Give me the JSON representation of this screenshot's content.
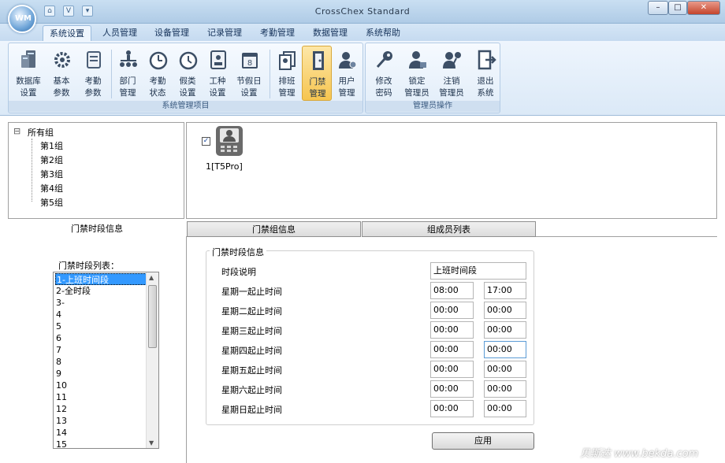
{
  "window": {
    "title": "CrossChex Standard",
    "logo_text": "WM",
    "quick_access": [
      "⌂",
      "V",
      "▾"
    ],
    "controls": [
      "–",
      "□",
      "✕"
    ]
  },
  "menu_tabs": [
    "系统设置",
    "人员管理",
    "设备管理",
    "记录管理",
    "考勤管理",
    "数据管理",
    "系统帮助"
  ],
  "ribbon": {
    "group1": {
      "label": "系统管理项目",
      "buttons": [
        {
          "line1": "数据库",
          "line2": "设置",
          "icon": "database-icon"
        },
        {
          "line1": "基本",
          "line2": "参数",
          "icon": "gear-icon"
        },
        {
          "line1": "考勤",
          "line2": "参数",
          "icon": "scroll-icon"
        },
        {
          "line1": "部门",
          "line2": "管理",
          "icon": "org-chart-icon"
        },
        {
          "line1": "考勤",
          "line2": "状态",
          "icon": "alarm-clock-icon"
        },
        {
          "line1": "假类",
          "line2": "设置",
          "icon": "clock-icon"
        },
        {
          "line1": "工种",
          "line2": "设置",
          "icon": "id-card-icon"
        },
        {
          "line1": "节假日",
          "line2": "设置",
          "icon": "calendar-icon"
        },
        {
          "line1": "排班",
          "line2": "管理",
          "icon": "schedule-icon"
        },
        {
          "line1": "门禁",
          "line2": "管理",
          "icon": "door-icon"
        },
        {
          "line1": "用户",
          "line2": "管理",
          "icon": "user-gear-icon"
        }
      ]
    },
    "group2": {
      "label": "管理员操作",
      "buttons": [
        {
          "line1": "修改",
          "line2": "密码",
          "icon": "key-icon"
        },
        {
          "line1": "锁定",
          "line2": "管理员",
          "icon": "user-lock-icon"
        },
        {
          "line1": "注销",
          "line2": "管理员",
          "icon": "user-key-icon"
        },
        {
          "line1": "退出",
          "line2": "系统",
          "icon": "exit-icon"
        }
      ]
    }
  },
  "tree": {
    "root_toggle": "⊟",
    "root": "所有组",
    "children": [
      "第1组",
      "第2组",
      "第3组",
      "第4组",
      "第5组"
    ]
  },
  "device": {
    "label": "1[T5Pro]",
    "checked": true
  },
  "bottom_tabs": [
    "门禁时段信息",
    "门禁组信息",
    "组成员列表"
  ],
  "timezone_list": {
    "label": "门禁时段列表：",
    "items": [
      "1-上班时间段",
      "2-全时段",
      "3-",
      "4",
      "5",
      "6",
      "7",
      "8",
      "9",
      "10",
      "11",
      "12",
      "13",
      "14",
      "15"
    ],
    "selected": 0
  },
  "timezone_info": {
    "legend": "门禁时段信息",
    "desc_label": "时段说明",
    "desc_value": "上班时间段",
    "rows": [
      {
        "label": "星期一起止时间",
        "start": "08:00",
        "end": "17:00"
      },
      {
        "label": "星期二起止时间",
        "start": "00:00",
        "end": "00:00"
      },
      {
        "label": "星期三起止时间",
        "start": "00:00",
        "end": "00:00"
      },
      {
        "label": "星期四起止时间",
        "start": "00:00",
        "end": "00:00"
      },
      {
        "label": "星期五起止时间",
        "start": "00:00",
        "end": "00:00"
      },
      {
        "label": "星期六起止时间",
        "start": "00:00",
        "end": "00:00"
      },
      {
        "label": "星期日起止时间",
        "start": "00:00",
        "end": "00:00"
      }
    ]
  },
  "apply_label": "应用",
  "watermark": "贝斯达 www.bekda.com",
  "colors": {
    "accent": "#f6c550",
    "ribbon_bg": "#dbe9f7",
    "selection": "#3399ff"
  }
}
